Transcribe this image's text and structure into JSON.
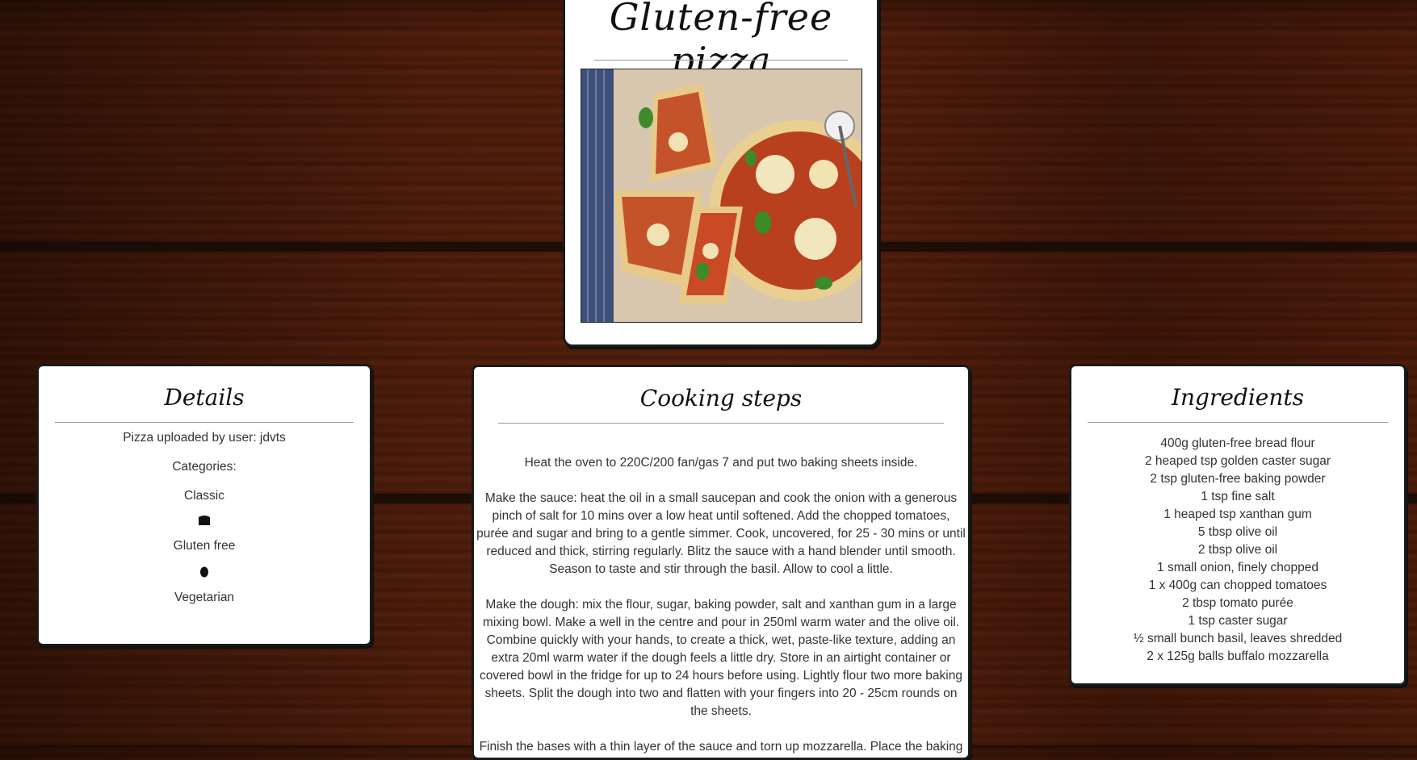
{
  "recipe": {
    "title": "Gluten-free pizza"
  },
  "details": {
    "heading": "Details",
    "uploaded_by": "Pizza uploaded by user: jdvts",
    "categories_label": "Categories:",
    "categories": [
      {
        "name": "Classic",
        "icon": "pizza-crust-icon"
      },
      {
        "name": "Gluten free",
        "icon": "grain-icon"
      },
      {
        "name": "Vegetarian",
        "icon": null
      }
    ]
  },
  "steps": {
    "heading": "Cooking steps",
    "items": [
      "Heat the oven to 220C/200 fan/gas 7 and put two baking sheets inside.",
      "Make the sauce: heat the oil in a small saucepan and cook the onion with a generous pinch of salt for 10 mins over a low heat until softened. Add the chopped tomatoes, purée and sugar and bring to a gentle simmer. Cook, uncovered, for 25 - 30 mins or until reduced and thick, stirring regularly. Blitz the sauce with a hand blender until smooth. Season to taste and stir through the basil. Allow to cool a little.",
      "Make the dough: mix the flour, sugar, baking powder, salt and xanthan gum in a large mixing bowl. Make a well in the centre and pour in 250ml warm water and the olive oil. Combine quickly with your hands, to create a thick, wet, paste-like texture, adding an extra 20ml warm water if the dough feels a little dry. Store in an airtight container or covered bowl in the fridge for up to 24 hours before using. Lightly flour two more baking sheets. Split the dough into two and flatten with your fingers into 20 - 25cm rounds on the sheets.",
      "Finish the bases with a thin layer of the sauce and torn up mozzarella. Place the baking"
    ]
  },
  "ingredients": {
    "heading": "Ingredients",
    "items": [
      "400g gluten-free bread flour",
      "2 heaped tsp golden caster sugar",
      "2 tsp gluten-free baking powder",
      "1 tsp fine salt",
      "1 heaped tsp xanthan gum",
      "5 tbsp olive oil",
      "2 tbsp olive oil",
      "1 small onion, finely chopped",
      "1 x 400g can chopped tomatoes",
      "2 tbsp tomato purée",
      "1 tsp caster sugar",
      "½ small bunch basil, leaves shredded",
      "2 x 125g balls buffalo mozzarella"
    ]
  }
}
